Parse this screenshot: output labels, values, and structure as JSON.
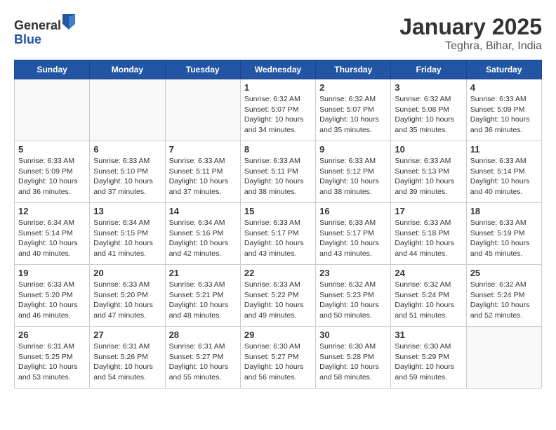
{
  "logo": {
    "general": "General",
    "blue": "Blue"
  },
  "header": {
    "title": "January 2025",
    "subtitle": "Teghra, Bihar, India"
  },
  "weekdays": [
    "Sunday",
    "Monday",
    "Tuesday",
    "Wednesday",
    "Thursday",
    "Friday",
    "Saturday"
  ],
  "weeks": [
    [
      {
        "day": "",
        "info": ""
      },
      {
        "day": "",
        "info": ""
      },
      {
        "day": "",
        "info": ""
      },
      {
        "day": "1",
        "info": "Sunrise: 6:32 AM\nSunset: 5:07 PM\nDaylight: 10 hours\nand 34 minutes."
      },
      {
        "day": "2",
        "info": "Sunrise: 6:32 AM\nSunset: 5:07 PM\nDaylight: 10 hours\nand 35 minutes."
      },
      {
        "day": "3",
        "info": "Sunrise: 6:32 AM\nSunset: 5:08 PM\nDaylight: 10 hours\nand 35 minutes."
      },
      {
        "day": "4",
        "info": "Sunrise: 6:33 AM\nSunset: 5:09 PM\nDaylight: 10 hours\nand 36 minutes."
      }
    ],
    [
      {
        "day": "5",
        "info": "Sunrise: 6:33 AM\nSunset: 5:09 PM\nDaylight: 10 hours\nand 36 minutes."
      },
      {
        "day": "6",
        "info": "Sunrise: 6:33 AM\nSunset: 5:10 PM\nDaylight: 10 hours\nand 37 minutes."
      },
      {
        "day": "7",
        "info": "Sunrise: 6:33 AM\nSunset: 5:11 PM\nDaylight: 10 hours\nand 37 minutes."
      },
      {
        "day": "8",
        "info": "Sunrise: 6:33 AM\nSunset: 5:11 PM\nDaylight: 10 hours\nand 38 minutes."
      },
      {
        "day": "9",
        "info": "Sunrise: 6:33 AM\nSunset: 5:12 PM\nDaylight: 10 hours\nand 38 minutes."
      },
      {
        "day": "10",
        "info": "Sunrise: 6:33 AM\nSunset: 5:13 PM\nDaylight: 10 hours\nand 39 minutes."
      },
      {
        "day": "11",
        "info": "Sunrise: 6:33 AM\nSunset: 5:14 PM\nDaylight: 10 hours\nand 40 minutes."
      }
    ],
    [
      {
        "day": "12",
        "info": "Sunrise: 6:34 AM\nSunset: 5:14 PM\nDaylight: 10 hours\nand 40 minutes."
      },
      {
        "day": "13",
        "info": "Sunrise: 6:34 AM\nSunset: 5:15 PM\nDaylight: 10 hours\nand 41 minutes."
      },
      {
        "day": "14",
        "info": "Sunrise: 6:34 AM\nSunset: 5:16 PM\nDaylight: 10 hours\nand 42 minutes."
      },
      {
        "day": "15",
        "info": "Sunrise: 6:33 AM\nSunset: 5:17 PM\nDaylight: 10 hours\nand 43 minutes."
      },
      {
        "day": "16",
        "info": "Sunrise: 6:33 AM\nSunset: 5:17 PM\nDaylight: 10 hours\nand 43 minutes."
      },
      {
        "day": "17",
        "info": "Sunrise: 6:33 AM\nSunset: 5:18 PM\nDaylight: 10 hours\nand 44 minutes."
      },
      {
        "day": "18",
        "info": "Sunrise: 6:33 AM\nSunset: 5:19 PM\nDaylight: 10 hours\nand 45 minutes."
      }
    ],
    [
      {
        "day": "19",
        "info": "Sunrise: 6:33 AM\nSunset: 5:20 PM\nDaylight: 10 hours\nand 46 minutes."
      },
      {
        "day": "20",
        "info": "Sunrise: 6:33 AM\nSunset: 5:20 PM\nDaylight: 10 hours\nand 47 minutes."
      },
      {
        "day": "21",
        "info": "Sunrise: 6:33 AM\nSunset: 5:21 PM\nDaylight: 10 hours\nand 48 minutes."
      },
      {
        "day": "22",
        "info": "Sunrise: 6:33 AM\nSunset: 5:22 PM\nDaylight: 10 hours\nand 49 minutes."
      },
      {
        "day": "23",
        "info": "Sunrise: 6:32 AM\nSunset: 5:23 PM\nDaylight: 10 hours\nand 50 minutes."
      },
      {
        "day": "24",
        "info": "Sunrise: 6:32 AM\nSunset: 5:24 PM\nDaylight: 10 hours\nand 51 minutes."
      },
      {
        "day": "25",
        "info": "Sunrise: 6:32 AM\nSunset: 5:24 PM\nDaylight: 10 hours\nand 52 minutes."
      }
    ],
    [
      {
        "day": "26",
        "info": "Sunrise: 6:31 AM\nSunset: 5:25 PM\nDaylight: 10 hours\nand 53 minutes."
      },
      {
        "day": "27",
        "info": "Sunrise: 6:31 AM\nSunset: 5:26 PM\nDaylight: 10 hours\nand 54 minutes."
      },
      {
        "day": "28",
        "info": "Sunrise: 6:31 AM\nSunset: 5:27 PM\nDaylight: 10 hours\nand 55 minutes."
      },
      {
        "day": "29",
        "info": "Sunrise: 6:30 AM\nSunset: 5:27 PM\nDaylight: 10 hours\nand 56 minutes."
      },
      {
        "day": "30",
        "info": "Sunrise: 6:30 AM\nSunset: 5:28 PM\nDaylight: 10 hours\nand 58 minutes."
      },
      {
        "day": "31",
        "info": "Sunrise: 6:30 AM\nSunset: 5:29 PM\nDaylight: 10 hours\nand 59 minutes."
      },
      {
        "day": "",
        "info": ""
      }
    ]
  ]
}
